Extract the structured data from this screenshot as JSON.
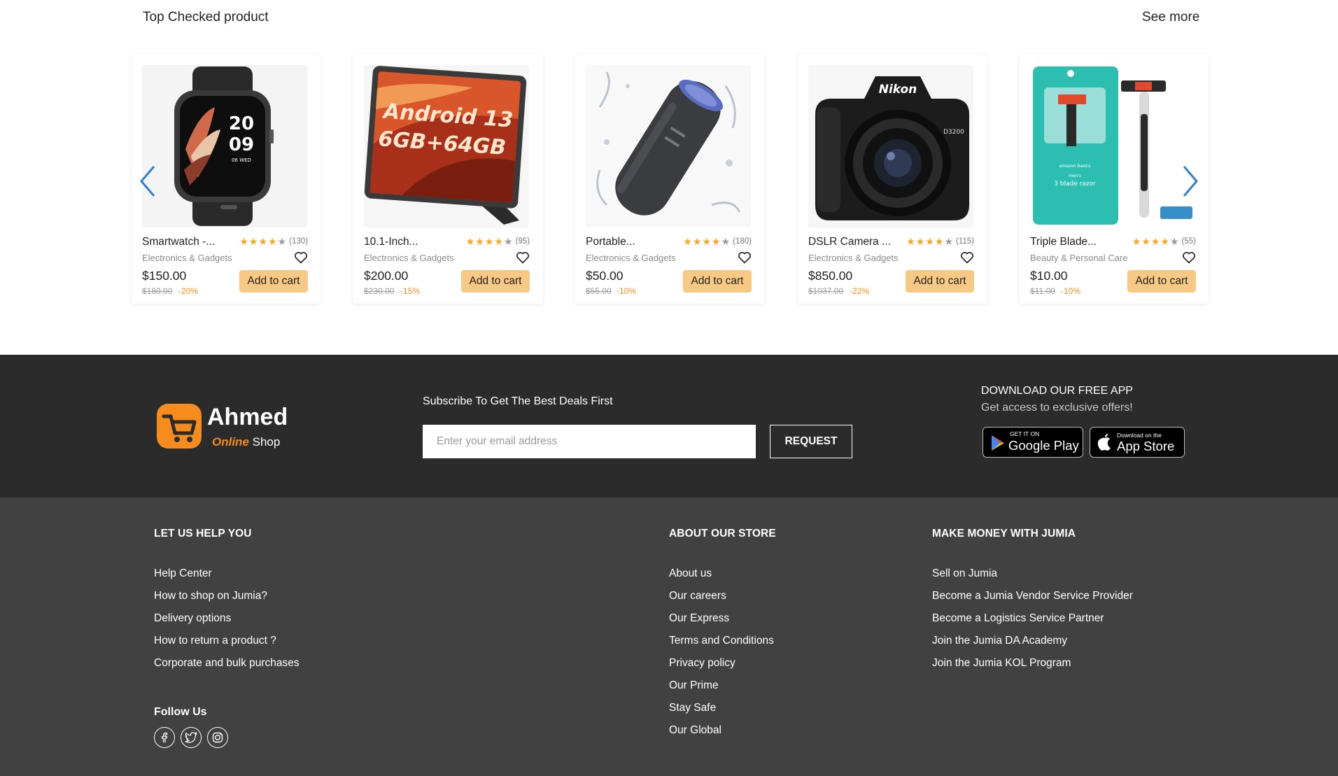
{
  "section": {
    "title": "Top Checked product",
    "see_more": "See more"
  },
  "products": [
    {
      "name": "Smartwatch -...",
      "rating": 4,
      "reviews": "(130)",
      "category": "Electronics & Gadgets",
      "price": "$150.00",
      "old_price": "$180.00",
      "discount": "-20%",
      "cta": "Add to cart",
      "image": "smartwatch",
      "watch_time_h": "20",
      "watch_time_m": "09",
      "watch_date": "06 WED"
    },
    {
      "name": "10.1-Inch...",
      "rating": 4,
      "reviews": "(95)",
      "category": "Electronics & Gadgets",
      "price": "$200.00",
      "old_price": "$230.00",
      "discount": "-15%",
      "cta": "Add to cart",
      "image": "tablet",
      "screen_line1": "Android 13",
      "screen_line2": "6GB+64GB"
    },
    {
      "name": "Portable...",
      "rating": 4,
      "reviews": "(180)",
      "category": "Electronics & Gadgets",
      "price": "$50.00",
      "old_price": "$55.00",
      "discount": "-10%",
      "cta": "Add to cart",
      "image": "speaker"
    },
    {
      "name": "DSLR Camera ...",
      "rating": 4,
      "reviews": "(115)",
      "category": "Electronics & Gadgets",
      "price": "$850.00",
      "old_price": "$1037.00",
      "discount": "-22%",
      "cta": "Add to cart",
      "image": "camera",
      "brand": "Nikon",
      "model": "D3200"
    },
    {
      "name": "Triple Blade...",
      "rating": 4,
      "reviews": "(55)",
      "category": "Beauty & Personal Care",
      "price": "$10.00",
      "old_price": "$11.00",
      "discount": "-10%",
      "cta": "Add to cart",
      "image": "razor",
      "pack_brand": "amazon basics",
      "pack_line1": "men's",
      "pack_line2": "3 blade razor"
    }
  ],
  "newsletter": {
    "logo_name": "Ahmed",
    "logo_sub_accent": "Online",
    "logo_sub_rest": "Shop",
    "label": "Subscribe To Get The Best Deals First",
    "placeholder": "Enter your email address",
    "button": "REQUEST",
    "app_title": "DOWNLOAD OUR FREE APP",
    "app_subtitle": "Get access to exclusive offers!",
    "google_small": "GET IT ON",
    "google_big": "Google Play",
    "apple_small": "Download on the",
    "apple_big": "App Store"
  },
  "footer": {
    "help": {
      "title": "LET US HELP YOU",
      "links": [
        "Help Center",
        "How to shop on Jumia?",
        "Delivery options",
        "How to return a product ?",
        "Corporate and bulk purchases"
      ]
    },
    "about": {
      "title": "ABOUT OUR STORE",
      "links": [
        "About us",
        "Our careers",
        "Our Express",
        "Terms and Conditions",
        "Privacy policy",
        "Our Prime",
        "Stay Safe",
        "Our Global"
      ]
    },
    "money": {
      "title": "MAKE MONEY WITH JUMIA",
      "links": [
        "Sell on Jumia",
        "Become a Jumia Vendor Service Provider",
        "Become a Logistics Service Partner",
        "Join the Jumia DA Academy",
        "Join the Jumia KOL Program"
      ]
    },
    "follow_title": "Follow Us",
    "socials": [
      "facebook-icon",
      "twitter-icon",
      "instagram-icon"
    ]
  },
  "colors": {
    "accent_orange": "#f68b1e",
    "button_peach": "#f8c985",
    "star_gold": "#f6a623",
    "arrow_blue": "#2f80c8",
    "newsletter_bg": "#2b2b2b",
    "footer_bg": "#414141"
  }
}
